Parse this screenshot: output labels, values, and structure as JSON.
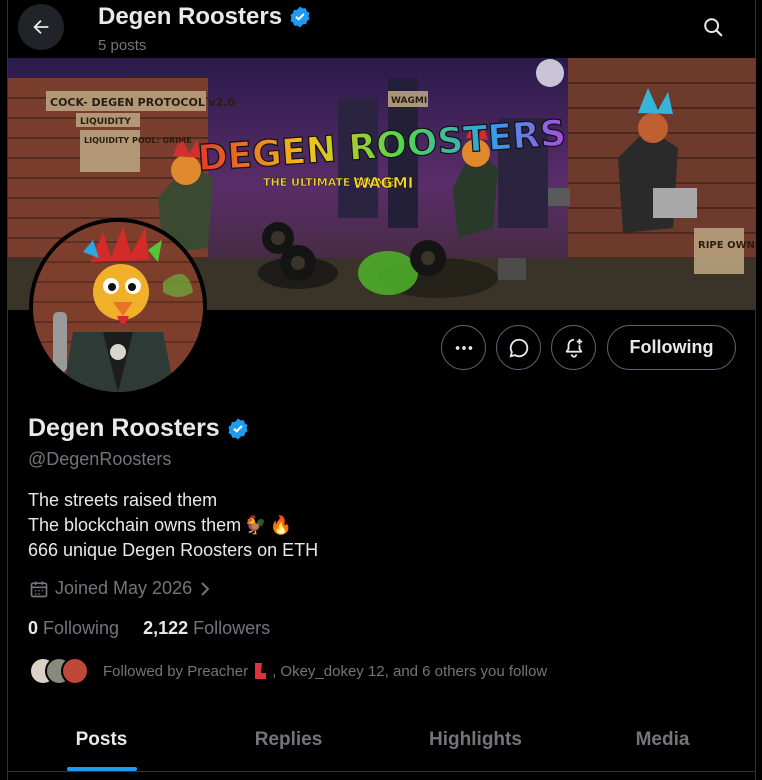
{
  "header": {
    "title": "Degen Roosters",
    "posts_count": "5 posts"
  },
  "banner": {
    "headline": "DEGEN ROOSTERS",
    "sign_protocol": "COCK- DEGEN PROTOCOL v2.0",
    "sign_liquidity": "LIQUIDITY",
    "sign_pool": "LIQUIDITY POOL: GRIME",
    "sign_ultimate": "THE ULTIMATE GRIME",
    "sign_wagmi": "WAGMI",
    "sign_wagmi_small": "WAGMI",
    "sign_rip": "RIPE OWNER"
  },
  "actions": {
    "following_label": "Following"
  },
  "profile": {
    "display_name": "Degen Roosters",
    "handle": "@DegenRoosters",
    "bio_line1": "The streets raised them",
    "bio_line2": "The blockchain owns them",
    "bio_emoji_chicken": "🐓",
    "bio_emoji_fire": "🔥",
    "bio_line3": "666 unique Degen Roosters on ETH",
    "joined": "Joined May 2026",
    "following_count": "0",
    "following_label": "Following",
    "followers_count": "2,122",
    "followers_label": "Followers",
    "followed_by_prefix": "Followed by Preacher",
    "followed_by_suffix": ", Okey_dokey 12, and 6 others you follow"
  },
  "tabs": [
    {
      "label": "Posts",
      "active": true
    },
    {
      "label": "Replies"
    },
    {
      "label": "Highlights"
    },
    {
      "label": "Media"
    }
  ],
  "colors": {
    "verified": "#1d9bf0",
    "accent": "#1d9bf0",
    "muted": "#71767b",
    "background": "#000000"
  }
}
